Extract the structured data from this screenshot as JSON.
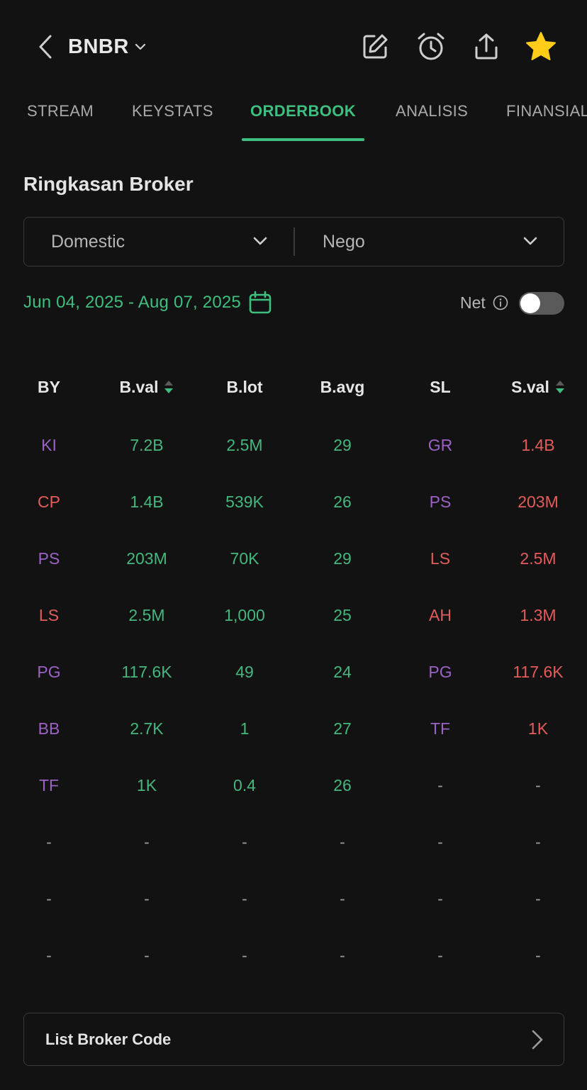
{
  "header": {
    "ticker": "BNBR",
    "icons": [
      "chevron-left-icon",
      "edit-icon",
      "alarm-icon",
      "share-icon",
      "star-icon"
    ],
    "star_color": "#FFCC1A"
  },
  "tabs": [
    {
      "label": "STREAM",
      "active": false
    },
    {
      "label": "KEYSTATS",
      "active": false
    },
    {
      "label": "ORDERBOOK",
      "active": true
    },
    {
      "label": "ANALISIS",
      "active": false
    },
    {
      "label": "FINANSIAL",
      "active": false
    }
  ],
  "section": {
    "title": "Ringkasan Broker"
  },
  "filters": {
    "market": "Domestic",
    "board": "Nego"
  },
  "date_range": {
    "label": "Jun 04, 2025 - Aug 07, 2025"
  },
  "net": {
    "label": "Net",
    "enabled": false
  },
  "colors": {
    "accent": "#3FBF7F",
    "buy": "#46B67E",
    "sell": "#E25C5C",
    "foreign": "#9B62C4",
    "background": "#121212"
  },
  "table": {
    "headers": [
      "BY",
      "B.val",
      "B.lot",
      "B.avg",
      "SL",
      "S.val"
    ],
    "rows": [
      [
        {
          "t": "KI",
          "c": "purple"
        },
        {
          "t": "7.2B",
          "c": "green"
        },
        {
          "t": "2.5M",
          "c": "green"
        },
        {
          "t": "29",
          "c": "green"
        },
        {
          "t": "GR",
          "c": "purple"
        },
        {
          "t": "1.4B",
          "c": "red"
        }
      ],
      [
        {
          "t": "CP",
          "c": "red"
        },
        {
          "t": "1.4B",
          "c": "green"
        },
        {
          "t": "539K",
          "c": "green"
        },
        {
          "t": "26",
          "c": "green"
        },
        {
          "t": "PS",
          "c": "purple"
        },
        {
          "t": "203M",
          "c": "red"
        }
      ],
      [
        {
          "t": "PS",
          "c": "purple"
        },
        {
          "t": "203M",
          "c": "green"
        },
        {
          "t": "70K",
          "c": "green"
        },
        {
          "t": "29",
          "c": "green"
        },
        {
          "t": "LS",
          "c": "red"
        },
        {
          "t": "2.5M",
          "c": "red"
        }
      ],
      [
        {
          "t": "LS",
          "c": "red"
        },
        {
          "t": "2.5M",
          "c": "green"
        },
        {
          "t": "1,000",
          "c": "green"
        },
        {
          "t": "25",
          "c": "green"
        },
        {
          "t": "AH",
          "c": "red"
        },
        {
          "t": "1.3M",
          "c": "red"
        }
      ],
      [
        {
          "t": "PG",
          "c": "purple"
        },
        {
          "t": "117.6K",
          "c": "green"
        },
        {
          "t": "49",
          "c": "green"
        },
        {
          "t": "24",
          "c": "green"
        },
        {
          "t": "PG",
          "c": "purple"
        },
        {
          "t": "117.6K",
          "c": "red"
        }
      ],
      [
        {
          "t": "BB",
          "c": "purple"
        },
        {
          "t": "2.7K",
          "c": "green"
        },
        {
          "t": "1",
          "c": "green"
        },
        {
          "t": "27",
          "c": "green"
        },
        {
          "t": "TF",
          "c": "purple"
        },
        {
          "t": "1K",
          "c": "red"
        }
      ],
      [
        {
          "t": "TF",
          "c": "purple"
        },
        {
          "t": "1K",
          "c": "green"
        },
        {
          "t": "0.4",
          "c": "green"
        },
        {
          "t": "26",
          "c": "green"
        },
        {
          "t": "-",
          "c": "dash"
        },
        {
          "t": "-",
          "c": "dash"
        }
      ],
      [
        {
          "t": "-",
          "c": "dash"
        },
        {
          "t": "-",
          "c": "dash"
        },
        {
          "t": "-",
          "c": "dash"
        },
        {
          "t": "-",
          "c": "dash"
        },
        {
          "t": "-",
          "c": "dash"
        },
        {
          "t": "-",
          "c": "dash"
        }
      ],
      [
        {
          "t": "-",
          "c": "dash"
        },
        {
          "t": "-",
          "c": "dash"
        },
        {
          "t": "-",
          "c": "dash"
        },
        {
          "t": "-",
          "c": "dash"
        },
        {
          "t": "-",
          "c": "dash"
        },
        {
          "t": "-",
          "c": "dash"
        }
      ],
      [
        {
          "t": "-",
          "c": "dash"
        },
        {
          "t": "-",
          "c": "dash"
        },
        {
          "t": "-",
          "c": "dash"
        },
        {
          "t": "-",
          "c": "dash"
        },
        {
          "t": "-",
          "c": "dash"
        },
        {
          "t": "-",
          "c": "dash"
        }
      ]
    ]
  },
  "footer": {
    "list_broker_label": "List Broker Code"
  }
}
